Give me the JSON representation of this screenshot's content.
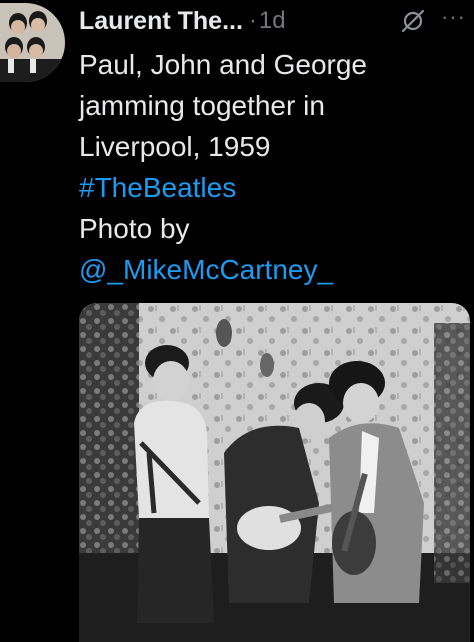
{
  "tweet": {
    "author_name": "Laurent The...",
    "separator": "·",
    "age": "1d",
    "text_lines": [
      "Paul, John and George",
      "jamming together in",
      "Liverpool, 1959"
    ],
    "hashtag": "#TheBeatles",
    "credit_text": "Photo by",
    "mention": "@_MikeMcCartney_",
    "media_description": "black and white photo of three young men playing guitars in a patterned-wallpaper room"
  },
  "icons": {
    "avatar": "beatles-group-avatar",
    "grok": "grok-icon",
    "more": "more-options-icon"
  },
  "colors": {
    "background": "#000000",
    "text": "#e7e9ea",
    "secondary": "#71767b",
    "link": "#1d9bf0"
  }
}
